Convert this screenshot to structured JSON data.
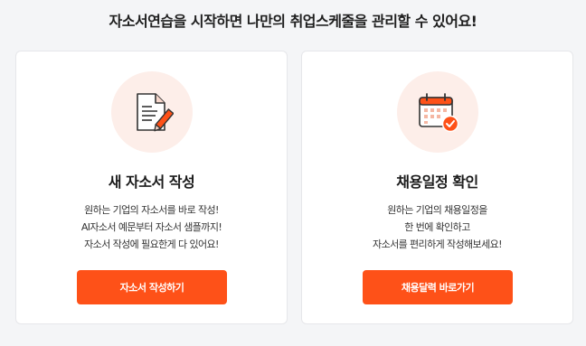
{
  "headline": "자소서연습을 시작하면 나만의 취업스케줄을 관리할 수 있어요!",
  "cards": [
    {
      "icon": "document-pencil-icon",
      "title": "새 자소서 작성",
      "desc": [
        "원하는 기업의 자소서를 바로 작성!",
        "AI자소서 예문부터 자소서 샘플까지!",
        "자소서 작성에 필요한게 다 있어요!"
      ],
      "button": "자소서 작성하기"
    },
    {
      "icon": "calendar-check-icon",
      "title": "채용일정 확인",
      "desc": [
        "원하는 기업의 채용일정을",
        "한 번에 확인하고",
        "자소서를 편리하게 작성해보세요!"
      ],
      "button": "채용달력 바로가기"
    }
  ],
  "colors": {
    "accent": "#fe5118",
    "icon_bg": "#fdeee9",
    "page_bg": "#f4f5f7"
  }
}
